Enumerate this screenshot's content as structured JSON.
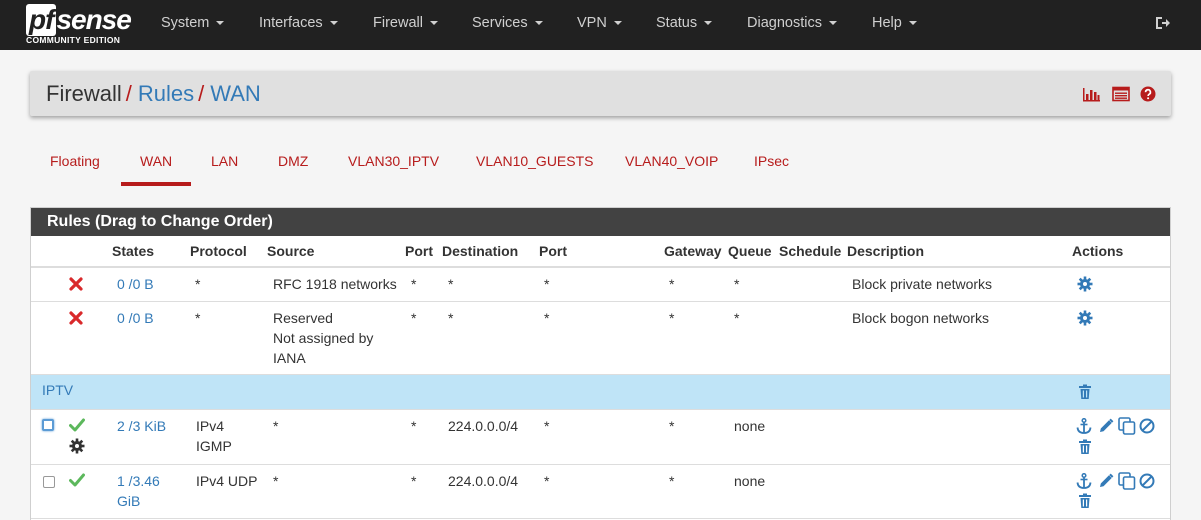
{
  "brand": {
    "logo_pf": "pf",
    "logo_sense": "sense",
    "edition": "COMMUNITY EDITION"
  },
  "nav": {
    "items": [
      "System",
      "Interfaces",
      "Firewall",
      "Services",
      "VPN",
      "Status",
      "Diagnostics",
      "Help"
    ],
    "logout_icon": "sign-out-icon"
  },
  "breadcrumb": {
    "root": "Firewall",
    "level1": "Rules",
    "level2": "WAN",
    "icons": [
      "bar-chart-icon",
      "list-table-icon",
      "help-icon"
    ]
  },
  "tabs": {
    "items": [
      "Floating",
      "WAN",
      "LAN",
      "DMZ",
      "VLAN30_IPTV",
      "VLAN10_GUESTS",
      "VLAN40_VOIP",
      "IPsec"
    ],
    "active": "WAN"
  },
  "rules": {
    "title": "Rules (Drag to Change Order)",
    "columns": [
      "States",
      "Protocol",
      "Source",
      "Port",
      "Destination",
      "Port",
      "Gateway",
      "Queue",
      "Schedule",
      "Description",
      "Actions"
    ],
    "rows": [
      {
        "status_icon": "block-x-icon",
        "states": "0 /0 B",
        "protocol": "*",
        "source": "RFC 1918 networks",
        "source_port": "*",
        "destination": "*",
        "dest_port": "*",
        "gateway": "*",
        "queue": "*",
        "schedule": "",
        "description": "Block private networks"
      },
      {
        "status_icon": "block-x-icon",
        "states": "0 /0 B",
        "protocol": "*",
        "source_line1": "Reserved",
        "source_line2": "Not assigned by",
        "source_line3": "IANA",
        "source_port": "*",
        "destination": "*",
        "dest_port": "*",
        "gateway": "*",
        "queue": "*",
        "schedule": "",
        "description": "Block bogon networks"
      },
      {
        "status_icon": "pass-check-icon",
        "states": "2 /3 KiB",
        "protocol_line1": "IPv4",
        "protocol_line2": "IGMP",
        "source": "*",
        "source_port": "*",
        "destination": "224.0.0.0/4",
        "dest_port": "*",
        "gateway": "*",
        "queue": "none",
        "schedule": "",
        "description": ""
      },
      {
        "status_icon": "pass-check-icon",
        "states_line1": "1 /3.46",
        "states_line2": "GiB",
        "protocol": "IPv4 UDP",
        "source": "*",
        "source_port": "*",
        "destination": "224.0.0.0/4",
        "dest_port": "*",
        "gateway": "*",
        "queue": "none",
        "schedule": "",
        "description": ""
      }
    ],
    "separator": {
      "label": "IPTV"
    }
  },
  "colors": {
    "navbar": "#212121",
    "accent_red": "#b71c1c",
    "link_blue": "#337ab7",
    "separator_bg": "#bfe4f7",
    "check_green": "#5cb85c"
  }
}
